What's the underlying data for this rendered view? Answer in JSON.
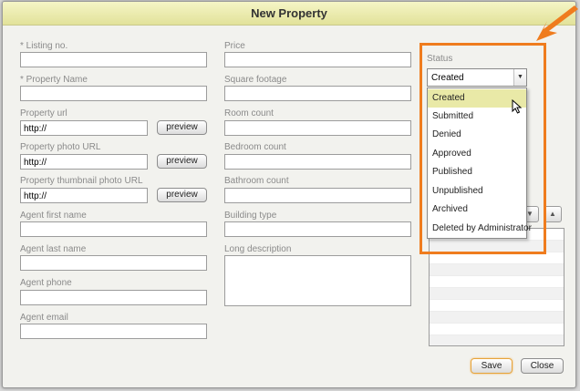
{
  "dialog": {
    "title": "New Property"
  },
  "left_fields": [
    {
      "label": "* Listing no.",
      "value": ""
    },
    {
      "label": "* Property Name",
      "value": ""
    },
    {
      "label": "Property url",
      "value": "http://",
      "preview": "preview"
    },
    {
      "label": "Property photo URL",
      "value": "http://",
      "preview": "preview"
    },
    {
      "label": "Property thumbnail photo URL",
      "value": "http://",
      "preview": "preview"
    },
    {
      "label": "Agent first name",
      "value": ""
    },
    {
      "label": "Agent last name",
      "value": ""
    },
    {
      "label": "Agent phone",
      "value": ""
    },
    {
      "label": "Agent email",
      "value": ""
    }
  ],
  "middle_fields": [
    {
      "label": "Price",
      "value": ""
    },
    {
      "label": "Square footage",
      "value": ""
    },
    {
      "label": "Room count",
      "value": ""
    },
    {
      "label": "Bedroom count",
      "value": ""
    },
    {
      "label": "Bathroom count",
      "value": ""
    },
    {
      "label": "Building type",
      "value": ""
    },
    {
      "label": "Long description",
      "value": ""
    }
  ],
  "status": {
    "label": "Status",
    "selected": "Created",
    "options": [
      "Created",
      "Submitted",
      "Denied",
      "Approved",
      "Published",
      "Unpublished",
      "Archived",
      "Deleted by Administrator"
    ]
  },
  "buttons": {
    "save": "Save",
    "close": "Close"
  },
  "colors": {
    "highlight": "#ef7c1e",
    "title_bar": "#e9e9a7",
    "selected_option": "#e9e9a7"
  },
  "icons": {
    "dropdown": "chevron-down-icon",
    "scroll_up": "chevron-up-icon",
    "callout": "orange-arrow-icon",
    "cursor": "mouse-pointer-icon"
  }
}
